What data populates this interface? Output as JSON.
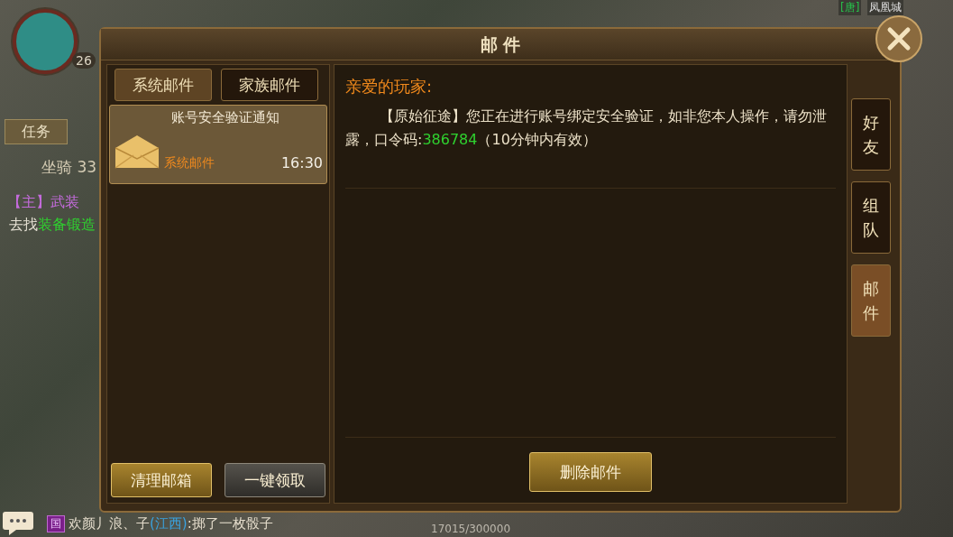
{
  "hud": {
    "level": "26",
    "quest_tab": "任务",
    "mount": "坐骑 33",
    "quest_title": "【主】武装",
    "quest_prefix": "去找",
    "quest_target": "装备锻造",
    "region_tag": "[唐]",
    "city": "凤凰城",
    "exp": "17015/300000"
  },
  "chat": {
    "channel": "国",
    "name": "欢颜丿浪、子",
    "origin": "(江西)",
    "message": ":掷了一枚骰子"
  },
  "dialog": {
    "title": "邮 件",
    "mail_tabs": [
      {
        "label": "系统邮件",
        "selected": true
      },
      {
        "label": "家族邮件",
        "selected": false
      }
    ],
    "mails": [
      {
        "subject": "账号安全验证通知",
        "sender": "系统邮件",
        "time": "16:30",
        "selected": true
      }
    ],
    "list_buttons": [
      {
        "label": "清理邮箱",
        "kind": "gold"
      },
      {
        "label": "一键领取",
        "kind": "grey"
      }
    ],
    "greeting": "亲爱的玩家:",
    "message": {
      "before": "【原始征途】您正在进行账号绑定安全验证，如非您本人操作，请勿泄露，口令码:",
      "code": "386784",
      "after": "（10分钟内有效）"
    },
    "delete_button": "删除邮件",
    "side_tabs": [
      {
        "label": "好友",
        "selected": false
      },
      {
        "label": "组队",
        "selected": false
      },
      {
        "label": "邮件",
        "selected": true
      }
    ]
  }
}
